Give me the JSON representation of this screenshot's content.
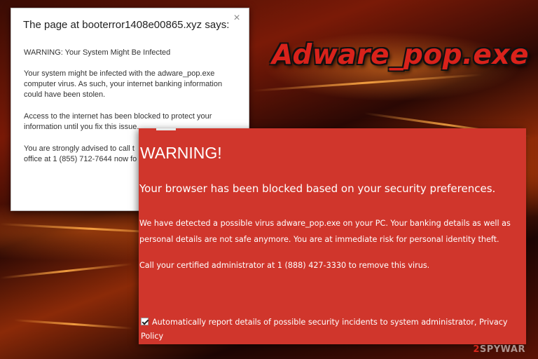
{
  "headline": "Adware_pop.exe",
  "alert_dialog": {
    "title": "The page at booterror1408e00865.xyz says:",
    "close_glyph": "×",
    "warning": "WARNING: Your System Might Be Infected",
    "para1_line1": "Your system might be infected with the adware_pop.exe",
    "para1_line2": "computer virus. As such, your internet banking information",
    "para1_line3": "could have been stolen.",
    "para2_line1": "Access to the internet has been blocked to protect your",
    "para2_line2": "information until you fix this issue.",
    "para3_line1": "You are strongly advised to call t",
    "para3_line2": "office at 1 (855) 712-7644 now fo"
  },
  "warning_page": {
    "title": "WARNING!",
    "subtitle": "Your browser has been blocked based on your security preferences.",
    "line1": "We have detected a possible virus adware_pop.exe on your PC. Your banking details as well as",
    "line2": "personal details are not safe anymore. You are at immediate risk for personal identity theft.",
    "line3": "Call your certified administrator at 1 (888) 427-3330 to remove this virus.",
    "checkbox_label": "Automatically report details of possible security incidents to system administrator,",
    "privacy_link": "Privacy Policy",
    "checkbox_checked": true,
    "background_color": "#d0362c"
  },
  "watermark": {
    "prefix": "2",
    "text": "SPYWAR"
  }
}
